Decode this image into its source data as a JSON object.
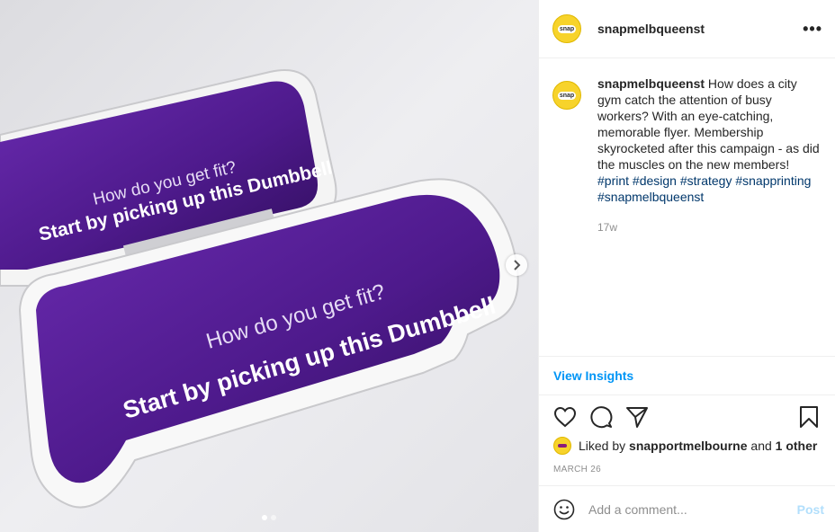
{
  "post": {
    "username": "snapmelbqueenst",
    "avatar_logo": "snap",
    "more_icon": "ellipsis-icon",
    "photo": {
      "card_text_line1": "How do you get fit?",
      "card_text_line2": "Start by picking up this Dumbbell",
      "next_icon": "chevron-right-icon",
      "page_count": 2,
      "active_page": 1
    },
    "caption": {
      "username": "snapmelbqueenst",
      "text": "How does a city gym catch the attention of busy workers? With an eye-catching, memorable flyer. Membership skyrocketed after this campaign - as did the muscles on the new members!",
      "hashtags": [
        "#print",
        "#design",
        "#strategy",
        "#snapprinting",
        "#snapmelbqueenst"
      ],
      "age": "17w"
    },
    "view_insights": "View Insights",
    "actions": {
      "like_icon": "heart-icon",
      "comment_icon": "comment-icon",
      "share_icon": "share-icon",
      "save_icon": "bookmark-icon"
    },
    "likes": {
      "prefix": "Liked by",
      "user": "snapportmelbourne",
      "connector": "and",
      "others": "1 other"
    },
    "date": "MARCH 26",
    "comment": {
      "emoji_icon": "smiley-icon",
      "placeholder": "Add a comment...",
      "post_label": "Post"
    },
    "colors": {
      "accent_blue": "#0095f6",
      "post_disabled": "#b2dffc",
      "hashtag": "#00376b",
      "brand_yellow": "#f7d32b",
      "dumbbell_purple": "#5a1f9a"
    }
  }
}
